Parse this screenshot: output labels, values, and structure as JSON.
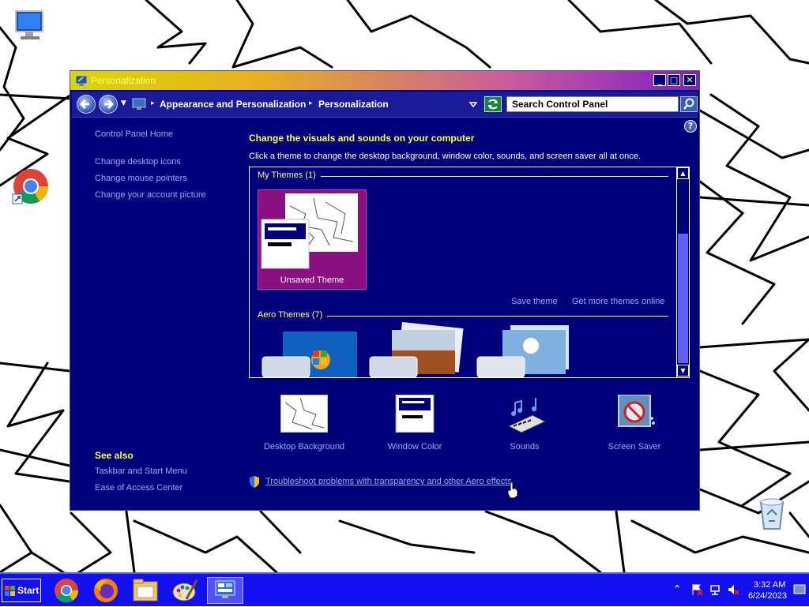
{
  "desktop": {
    "icons": [
      {
        "name": "computer",
        "label": ""
      },
      {
        "name": "google-chrome",
        "label": ""
      },
      {
        "name": "recycle-bin",
        "label": ""
      }
    ]
  },
  "window": {
    "title": "Personalization",
    "controls": {
      "minimize": "_",
      "maximize": "□",
      "close": "✕"
    }
  },
  "navbar": {
    "breadcrumbs": [
      "Appearance and Personalization",
      "Personalization"
    ],
    "search_value": "Search Control Panel"
  },
  "left_pane": {
    "home": "Control Panel Home",
    "links": [
      "Change desktop icons",
      "Change mouse pointers",
      "Change your account picture"
    ],
    "see_also_title": "See also",
    "see_also": [
      "Taskbar and Start Menu",
      "Ease of Access Center"
    ]
  },
  "main": {
    "heading": "Change the visuals and sounds on your computer",
    "subheading": "Click a theme to change the desktop background, window color, sounds, and screen saver all at once.",
    "groups": [
      {
        "label": "My Themes (1)"
      },
      {
        "label": "Aero Themes (7)"
      }
    ],
    "unsaved_theme": "Unsaved Theme",
    "save_theme": "Save theme",
    "get_more": "Get more themes online",
    "bottom_items": [
      "Desktop Background",
      "Window Color",
      "Sounds",
      "Screen Saver"
    ],
    "troubleshoot": "Troubleshoot problems with transparency and other Aero effects"
  },
  "taskbar": {
    "start_label": "Start",
    "time": "3:32 AM",
    "date": "6/24/2023",
    "apps": [
      "chrome-icon",
      "firefox-icon",
      "file-explorer-icon",
      "paint-icon",
      "control-panel-icon"
    ]
  },
  "colors": {
    "window_bg": "#00007a",
    "taskbar_bg": "#1010f0",
    "heading": "#ffff40",
    "link": "#8cb0ff"
  }
}
